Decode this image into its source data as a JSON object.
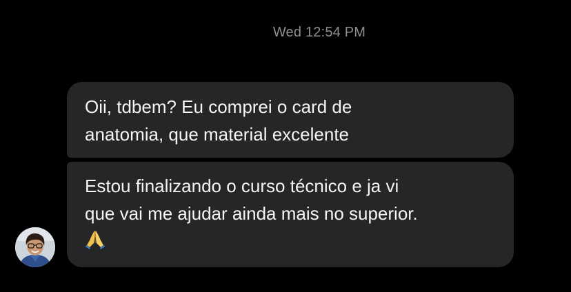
{
  "conversation": {
    "timestamp": "Wed 12:54 PM",
    "messages": [
      {
        "lines": [
          "Oii, tdbem? Eu comprei o card de",
          "anatomia, que material excelente"
        ]
      },
      {
        "lines": [
          "Estou finalizando o curso técnico e ja vi",
          "que vai me ajudar ainda mais no superior."
        ],
        "emoji": "folded-hands-icon"
      }
    ]
  },
  "colors": {
    "background": "#000000",
    "bubble": "#262628",
    "timestamp": "#8e8e93",
    "text": "#f5f5f5"
  }
}
